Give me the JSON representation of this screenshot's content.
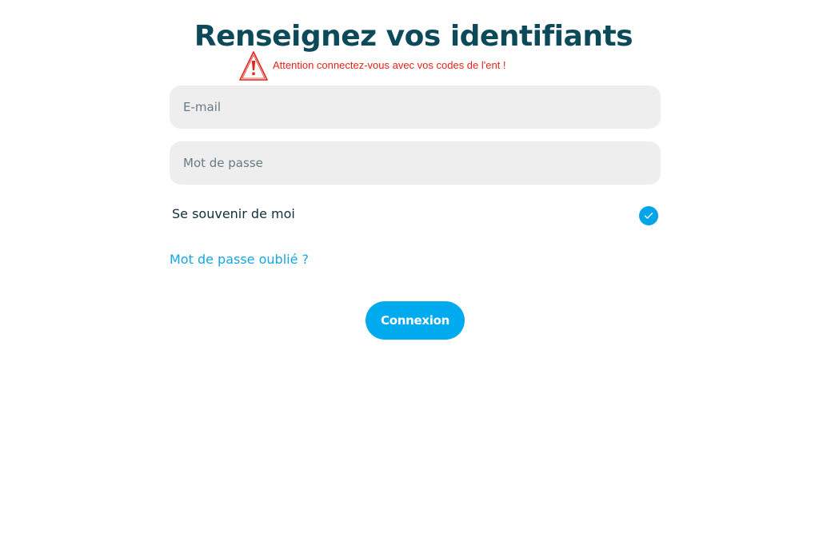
{
  "page": {
    "title": "Renseignez vos identifiants"
  },
  "warning": {
    "icon": "warning-triangle-icon",
    "text": "Attention connectez-vous avec vos codes de l'ent !",
    "color": "#e2231a"
  },
  "form": {
    "email": {
      "placeholder": "E-mail",
      "value": ""
    },
    "password": {
      "placeholder": "Mot de passe",
      "value": ""
    },
    "remember": {
      "label": "Se souvenir de moi",
      "checked": true,
      "icon": "checkmark-icon"
    },
    "forgot_link": "Mot de passe oublié ?",
    "submit_label": "Connexion"
  },
  "colors": {
    "title": "#0d4a59",
    "accent": "#00aaef",
    "input_bg": "#eeeeee"
  }
}
